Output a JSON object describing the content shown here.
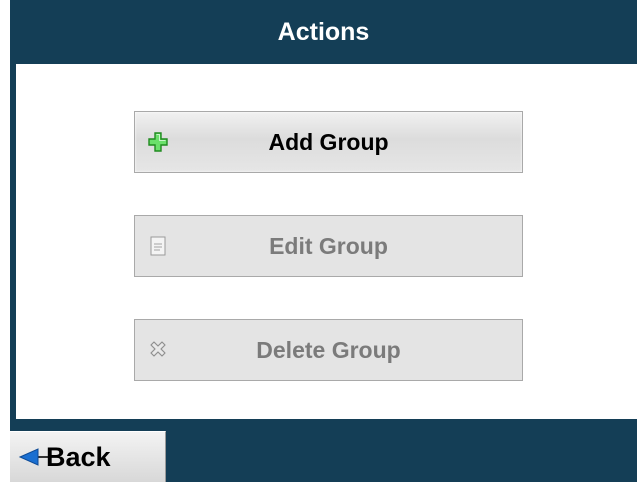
{
  "header": {
    "title": "Actions"
  },
  "actions": {
    "add": {
      "label": "Add Group",
      "icon": "plus-icon",
      "enabled": true
    },
    "edit": {
      "label": "Edit Group",
      "icon": "document-icon",
      "enabled": false
    },
    "delete": {
      "label": "Delete Group",
      "icon": "delete-x-icon",
      "enabled": false
    }
  },
  "footer": {
    "back_label": "Back",
    "back_icon": "left-arrow-icon"
  },
  "colors": {
    "panel": "#143e56",
    "content": "#ffffff",
    "enabled_text": "#000000",
    "disabled_text": "#7b7b7b",
    "plus_icon": "#33cc33",
    "arrow_icon": "#1a6fd1"
  }
}
